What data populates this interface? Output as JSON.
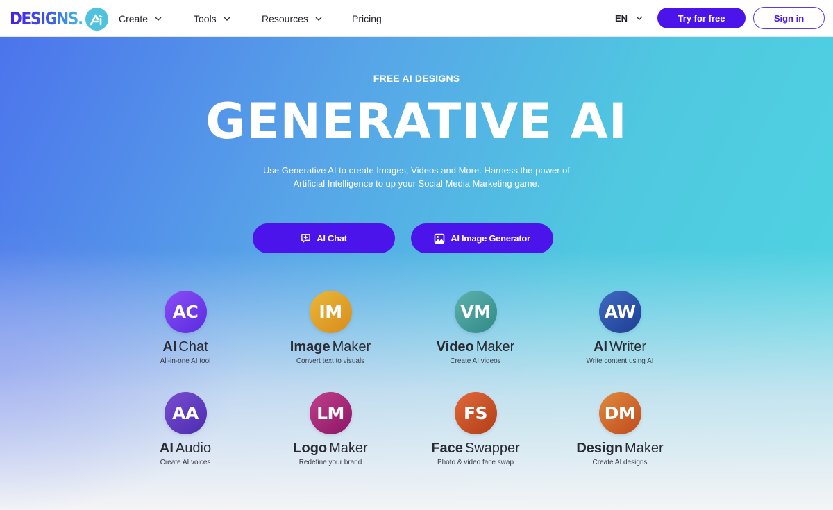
{
  "header": {
    "logo_text": "DESIGNS.",
    "logo_badge_icon": "ai-logo-icon",
    "nav": [
      {
        "label": "Create",
        "has_dropdown": true
      },
      {
        "label": "Tools",
        "has_dropdown": true
      },
      {
        "label": "Resources",
        "has_dropdown": true
      },
      {
        "label": "Pricing",
        "has_dropdown": false
      }
    ],
    "language": "EN",
    "try_label": "Try for free",
    "signin_label": "Sign in"
  },
  "hero": {
    "eyebrow": "FREE AI DESIGNS",
    "headline": "GENERATIVE AI",
    "subtitle_line1": "Use Generative AI to create Images, Videos and More. Harness the power of",
    "subtitle_line2": "Artificial Intelligence to up your Social Media Marketing game.",
    "cta_buttons": [
      {
        "label": "AI Chat",
        "icon": "chat-plus-icon"
      },
      {
        "label": "AI Image Generator",
        "icon": "image-icon"
      }
    ]
  },
  "tools": [
    {
      "initials": "AC",
      "bold": "AI",
      "rest": "Chat",
      "subtitle": "All-in-one AI tool",
      "color_from": "#8a4ef5",
      "color_to": "#5a2be0"
    },
    {
      "initials": "IM",
      "bold": "Image",
      "rest": "Maker",
      "subtitle": "Convert text to visuals",
      "color_from": "#e9b83a",
      "color_to": "#d88c1a"
    },
    {
      "initials": "VM",
      "bold": "Video",
      "rest": "Maker",
      "subtitle": "Create AI videos",
      "color_from": "#5fb1ad",
      "color_to": "#2f8a86"
    },
    {
      "initials": "AW",
      "bold": "AI",
      "rest": "Writer",
      "subtitle": "Write content using AI",
      "color_from": "#3f6bc0",
      "color_to": "#1e3d94"
    },
    {
      "initials": "AA",
      "bold": "AI",
      "rest": "Audio",
      "subtitle": "Create AI voices",
      "color_from": "#7a4ed0",
      "color_to": "#4b2bb0"
    },
    {
      "initials": "LM",
      "bold": "Logo",
      "rest": "Maker",
      "subtitle": "Redefine your brand",
      "color_from": "#c0408a",
      "color_to": "#8c1566"
    },
    {
      "initials": "FS",
      "bold": "Face",
      "rest": "Swapper",
      "subtitle": "Photo & video face swap",
      "color_from": "#e06a3a",
      "color_to": "#b23d16"
    },
    {
      "initials": "DM",
      "bold": "Design",
      "rest": "Maker",
      "subtitle": "Create AI designs",
      "color_from": "#e08a3e",
      "color_to": "#bf4a1c"
    }
  ],
  "colors": {
    "brand_primary": "#4a14eb",
    "logo_badge": "#4fc3de",
    "text_dark": "#2a2a33"
  }
}
